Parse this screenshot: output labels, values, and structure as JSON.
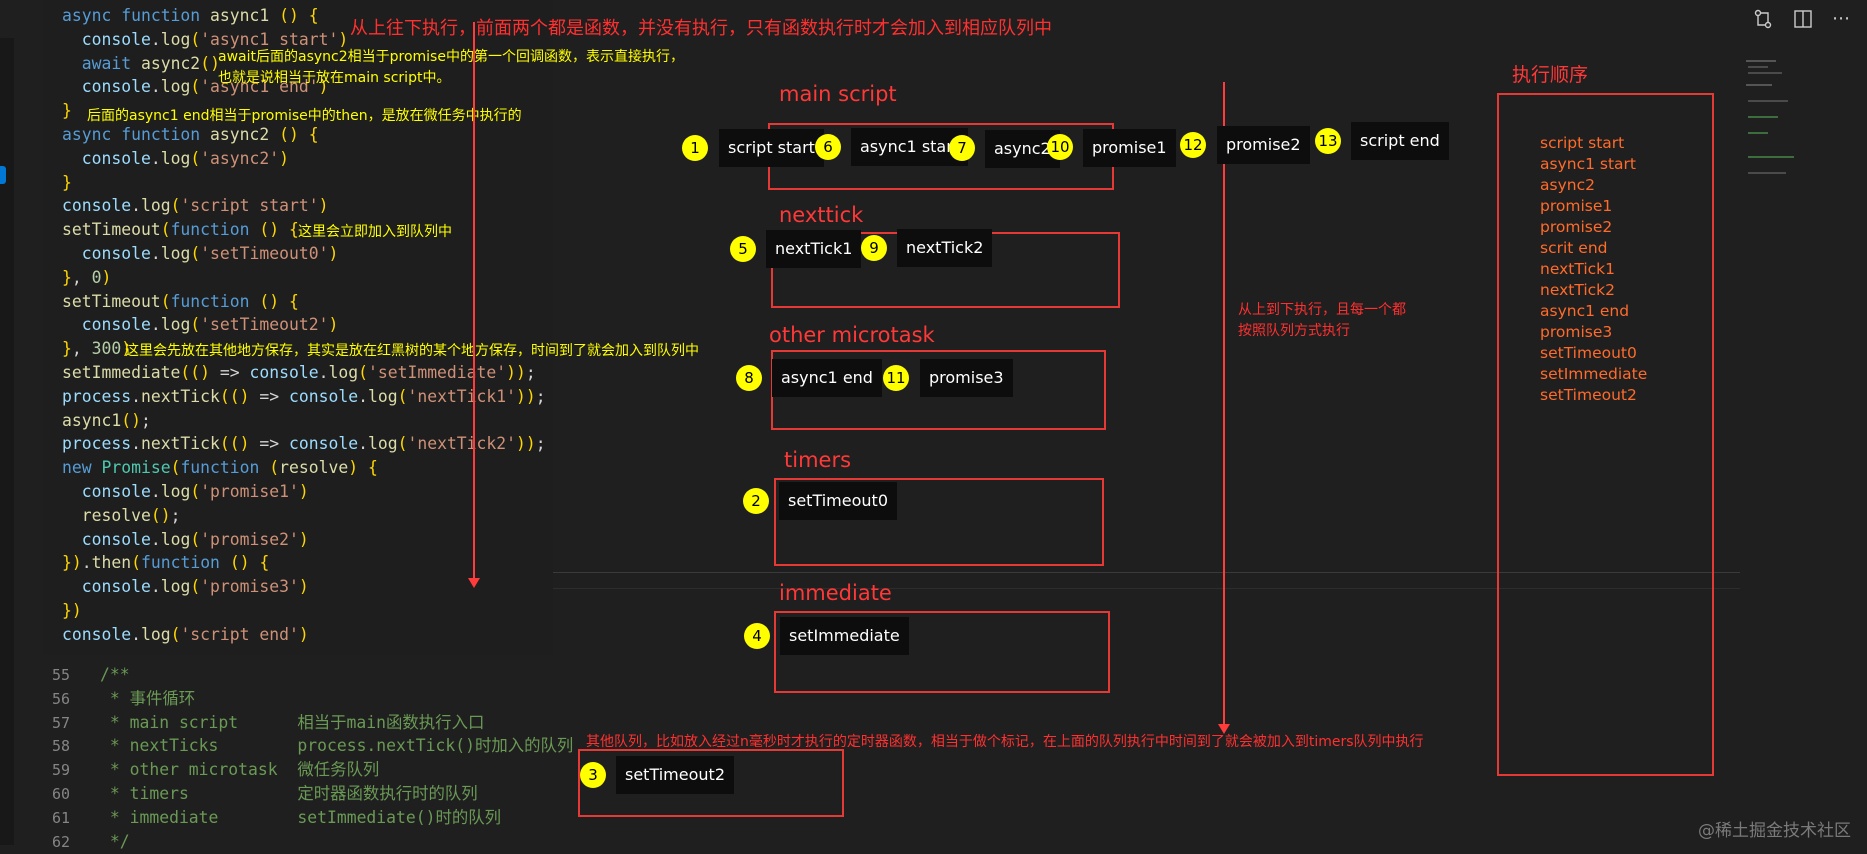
{
  "code": {
    "lines": [
      "async function async1 () {",
      "  console.log('async1 start')",
      "  await async2()",
      "  console.log('async1 end')",
      "}",
      "async function async2 () {",
      "  console.log('async2')",
      "}",
      "console.log('script start')",
      "setTimeout(function () {",
      "  console.log('setTimeout0')",
      "}, 0)",
      "setTimeout(function () {",
      "  console.log('setTimeout2')",
      "}, 300)",
      "setImmediate(() => console.log('setImmediate'));",
      "process.nextTick(() => console.log('nextTick1'));",
      "async1();",
      "process.nextTick(() => console.log('nextTick2'));",
      "new Promise(function (resolve) {",
      "  console.log('promise1')",
      "  resolve();",
      "  console.log('promise2')",
      "}).then(function () {",
      "  console.log('promise3')",
      "})",
      "console.log('script end')"
    ]
  },
  "comment_lines": [
    {
      "num": "55",
      "text": "/**"
    },
    {
      "num": "56",
      "text": " * 事件循环"
    },
    {
      "num": "57",
      "text": " * main script      相当于main函数执行入口"
    },
    {
      "num": "58",
      "text": " * nextTicks        process.nextTick()时加入的队列"
    },
    {
      "num": "59",
      "text": " * other microtask  微任务队列"
    },
    {
      "num": "60",
      "text": " * timers           定时器函数执行时的队列"
    },
    {
      "num": "61",
      "text": " * immediate        setImmediate()时的队列"
    },
    {
      "num": "62",
      "text": " */"
    }
  ],
  "annotations": {
    "top_note": "从上往下执行，前面两个都是函数，并没有执行，只有函数执行时才会加入到相应队列中",
    "await_note_1": "await后面的async2相当于promise中的第一个回调函数，表示直接执行，",
    "await_note_2": "也就是说相当于放在main script中。",
    "async1_end_note": "后面的async1 end相当于promise中的then，是放在微任务中执行的",
    "settimeout0_note": "这里会立即加入到队列中",
    "settimeout2_note": "这里会先放在其他地方保存，其实是放在红黑树的某个地方保存，时间到了就会加入到队列中",
    "order_note_1": "从上到下执行，且每一个都",
    "order_note_2": "按照队列方式执行",
    "other_queue_note": "其他队列，比如放入经过n毫秒时才执行的定时器函数，相当于做个标记，在上面的队列执行中时间到了就会被加入到timers队列中执行"
  },
  "queues": {
    "main_script": {
      "title": "main script",
      "items": [
        {
          "badge": "1",
          "label": "script start"
        },
        {
          "badge": "6",
          "label": "async1 start"
        },
        {
          "badge": "7",
          "label": "async2"
        },
        {
          "badge": "10",
          "label": "promise1"
        },
        {
          "badge": "12",
          "label": "promise2"
        },
        {
          "badge": "13",
          "label": "script end"
        }
      ]
    },
    "nexttick": {
      "title": "nexttick",
      "items": [
        {
          "badge": "5",
          "label": "nextTick1"
        },
        {
          "badge": "9",
          "label": "nextTick2"
        }
      ]
    },
    "other_microtask": {
      "title": "other microtask",
      "items": [
        {
          "badge": "8",
          "label": "async1 end"
        },
        {
          "badge": "11",
          "label": "promise3"
        }
      ]
    },
    "timers": {
      "title": "timers",
      "items": [
        {
          "badge": "2",
          "label": "setTimeout0"
        }
      ]
    },
    "immediate": {
      "title": "immediate",
      "items": [
        {
          "badge": "4",
          "label": "setImmediate"
        }
      ]
    },
    "other": {
      "items": [
        {
          "badge": "3",
          "label": "setTimeout2"
        }
      ]
    }
  },
  "execution_order": {
    "title": "执行顺序",
    "items": [
      "script start",
      "async1 start",
      "async2",
      "promise1",
      "promise2",
      "scrit end",
      "nextTick1",
      "nextTick2",
      "async1 end",
      "promise3",
      "setTimeout0",
      "setImmediate",
      "setTimeout2"
    ]
  },
  "watermark": "@稀土掘金技术社区",
  "colors": {
    "accent_red": "#ff3838",
    "badge_yellow": "#ffff00",
    "order_orange": "#ff6b2b",
    "editor_bg": "#1e1e1e"
  }
}
